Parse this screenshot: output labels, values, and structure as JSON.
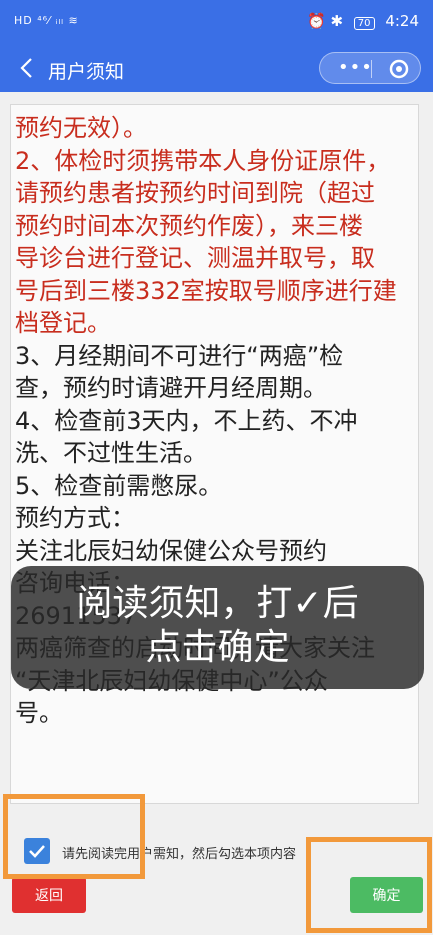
{
  "status": {
    "left": "HD ⁴⁶⁄ ᵢₗₗ ≋",
    "right_icons": "⏰ ✱",
    "battery": "70",
    "time": "4:24"
  },
  "nav": {
    "title": "用户须知",
    "more": "•••"
  },
  "notice": {
    "lines": [
      {
        "text": "预约无效）。",
        "red": true
      },
      {
        "text": "2、体检时须携带本人身份证原件，",
        "red": true
      },
      {
        "text": "请预约患者按预约时间到院（超过",
        "red": true
      },
      {
        "text": "预约时间本次预约作废），来三楼",
        "red": true
      },
      {
        "text": "导诊台进行登记、测温并取号，取",
        "red": true
      },
      {
        "text": "号后到三楼332室按取号顺序进行建",
        "red": true
      },
      {
        "text": "档登记。",
        "red": true
      },
      {
        "text": "3、月经期间不可进行“两癌”检",
        "red": false
      },
      {
        "text": "查，预约时请避开月经周期。",
        "red": false
      },
      {
        "text": "4、检查前3天内，不上药、不冲",
        "red": false
      },
      {
        "text": "洗、不过性生活。",
        "red": false
      },
      {
        "text": "5、检查前需憋尿。",
        "red": false
      },
      {
        "text": "预约方式：",
        "red": false
      },
      {
        "text": "关注北辰妇幼保健公众号预约",
        "red": false
      },
      {
        "text": "咨询电话：",
        "red": false
      },
      {
        "text": "26911537",
        "red": false
      },
      {
        "text": "两癌筛查的启动时间，请大家关注",
        "red": false
      },
      {
        "text": "“天津北辰妇幼保健中心”公众",
        "red": false
      },
      {
        "text": "号。",
        "red": false
      }
    ]
  },
  "toast": {
    "line1": "阅读须知，打✓后",
    "line2": "点击确定"
  },
  "agree": {
    "label": "请先阅读完用户需知，然后勾选本项内容",
    "checked": true
  },
  "buttons": {
    "back": "返回",
    "confirm": "确定"
  },
  "colors": {
    "primary": "#3a6fe6",
    "notice_red": "#c82d1e",
    "back_btn": "#e03030",
    "confirm_btn": "#4cbb63",
    "highlight": "#f2993b"
  }
}
